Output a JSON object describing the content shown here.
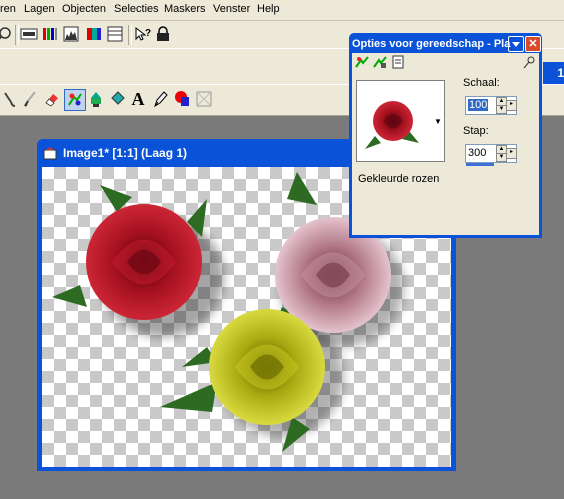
{
  "menu": [
    "ren",
    "Lagen",
    "Objecten",
    "Selecties",
    "Maskers",
    "Venster",
    "Help"
  ],
  "image_window": {
    "title": "Image1* [1:1] (Laag 1)"
  },
  "tool_options": {
    "title": "Opties voor gereedschap - Pla",
    "preset_name": "Gekleurde rozen",
    "scale_label": "Schaal:",
    "scale_value": "100",
    "step_label": "Stap:",
    "step_value": "300"
  },
  "background_window": {
    "title_fragment": "1"
  },
  "colors": {
    "titlebar": "#0a53d8",
    "workspace": "#7a7a7a",
    "chrome": "#ece9d8"
  },
  "toolbar_icons": [
    "zoom-icon",
    "screen-icon",
    "histogram-icon",
    "channels-icon",
    "layers-icon",
    "grid-icon",
    "help-context-icon",
    "lock-icon"
  ],
  "tool_icons": [
    "clone-brush-icon",
    "paint-brush-icon",
    "eraser-icon",
    "picture-tube-icon",
    "stamp-icon",
    "fill-icon",
    "text-icon",
    "pen-icon",
    "shape-icon",
    "deformation-icon"
  ]
}
